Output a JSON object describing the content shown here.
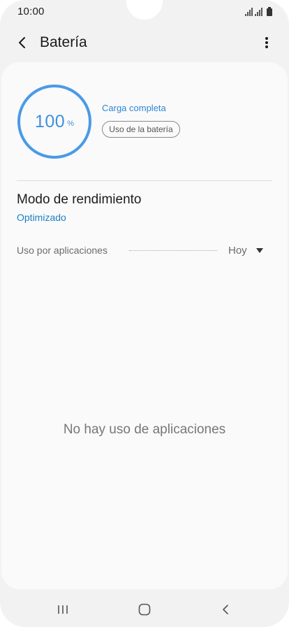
{
  "status_bar": {
    "time": "10:00"
  },
  "app_bar": {
    "title": "Batería",
    "back_icon": "chevron-left-icon",
    "more_icon": "more-vertical-icon"
  },
  "battery": {
    "percent": "100",
    "unit": "%",
    "level": 1.0,
    "status": "Carga completa",
    "usage_button_label": "Uso de la batería",
    "ring_color": "#4a9ae8"
  },
  "performance_mode": {
    "title": "Modo de rendimiento",
    "value": "Optimizado"
  },
  "app_usage": {
    "label": "Uso por aplicaciones",
    "period": "Hoy",
    "empty_message": "No hay uso de aplicaciones"
  },
  "colors": {
    "accent": "#2f86d6",
    "background": "#f2f2f2",
    "card": "#fafafa"
  },
  "navigation": {
    "recents_icon": "recents-icon",
    "home_icon": "home-icon",
    "back_icon": "back-icon"
  }
}
